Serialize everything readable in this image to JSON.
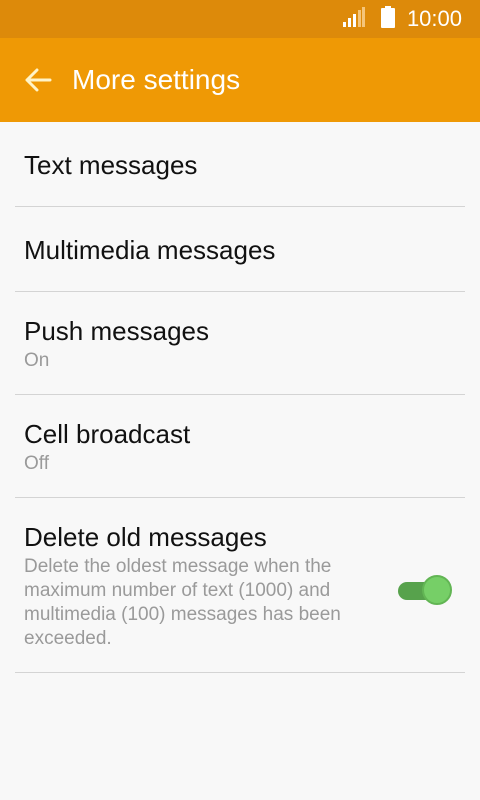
{
  "status_bar": {
    "time": "10:00"
  },
  "app_bar": {
    "title": "More settings"
  },
  "colors": {
    "status_bar": "#dd8a0a",
    "app_bar": "#ef9905",
    "toggle_on": "#76cf67",
    "background": "#f8f8f8"
  },
  "items": [
    {
      "title": "Text messages"
    },
    {
      "title": "Multimedia messages"
    },
    {
      "title": "Push messages",
      "subtitle": "On"
    },
    {
      "title": "Cell broadcast",
      "subtitle": "Off"
    },
    {
      "title": "Delete old messages",
      "subtitle": "Delete the oldest message when the maximum number of text (1000) and multimedia (100) messages has been exceeded.",
      "toggle_on": true
    }
  ],
  "icons": {
    "back": "back-arrow-icon",
    "signal": "signal-icon",
    "battery": "battery-icon"
  }
}
